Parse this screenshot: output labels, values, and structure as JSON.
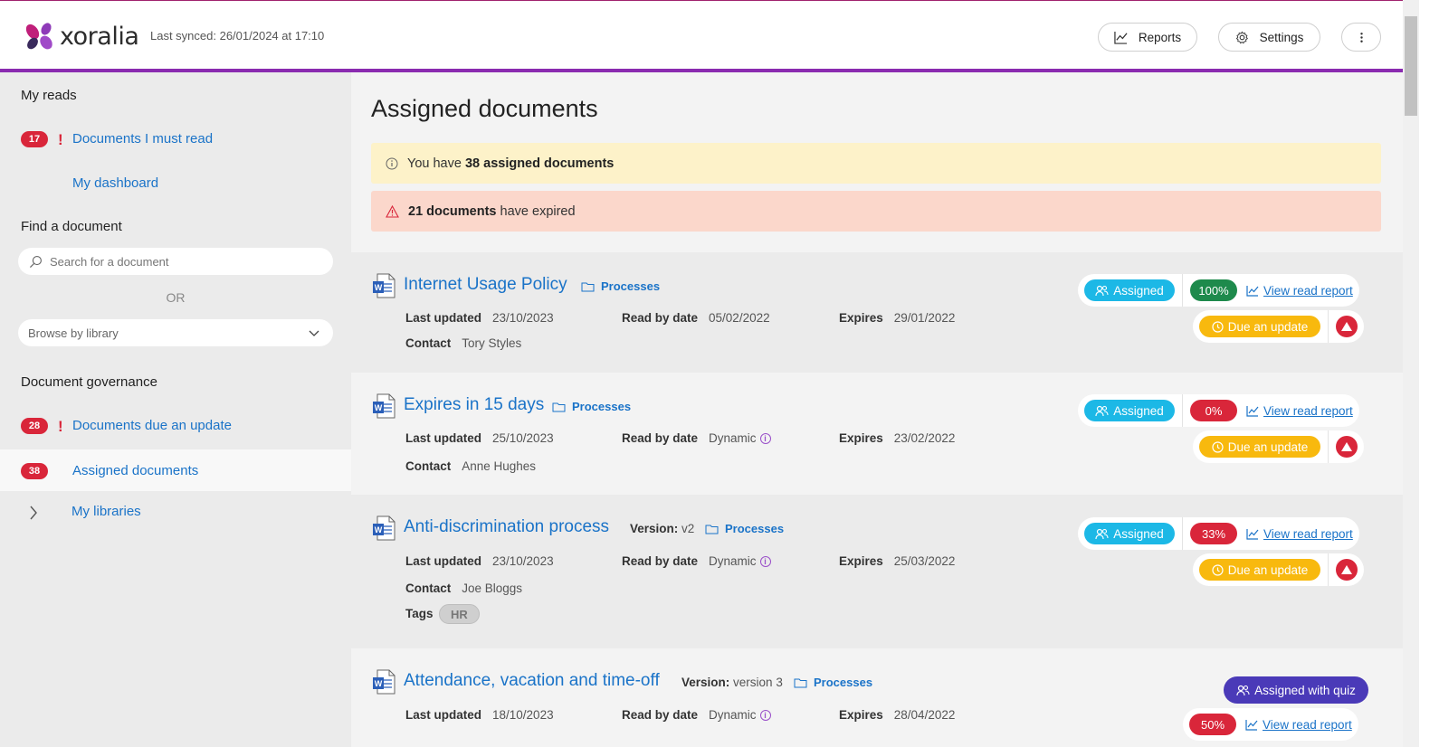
{
  "header": {
    "logo_text": "xoralia",
    "last_synced": "Last synced: 26/01/2024 at 17:10",
    "reports_label": "Reports",
    "settings_label": "Settings"
  },
  "sidebar": {
    "my_reads_heading": "My reads",
    "must_read_count": "17",
    "must_read_label": "Documents I must read",
    "dashboard_label": "My dashboard",
    "find_heading": "Find a document",
    "search_placeholder": "Search for a document",
    "or_label": "OR",
    "browse_label": "Browse by library",
    "governance_heading": "Document governance",
    "due_update_count": "28",
    "due_update_label": "Documents due an update",
    "assigned_count": "38",
    "assigned_label": "Assigned documents",
    "libraries_label": "My libraries"
  },
  "main": {
    "title": "Assigned documents",
    "info_prefix": "You have ",
    "info_bold": "38 assigned documents",
    "warn_bold": "21 documents",
    "warn_suffix": " have expired",
    "labels": {
      "last_updated": "Last updated",
      "read_by": "Read by date",
      "expires": "Expires",
      "contact": "Contact",
      "tags": "Tags",
      "version": "Version:",
      "view_report": "View read report",
      "due_update": "Due an update"
    },
    "docs": [
      {
        "title": "Internet Usage Policy",
        "folder": "Processes",
        "last_updated": "23/10/2023",
        "read_by": "05/02/2022",
        "expires": "29/01/2022",
        "contact": "Tory Styles",
        "status": "Assigned",
        "percent": "100%"
      },
      {
        "title": "Expires in 15 days",
        "folder": "Processes",
        "last_updated": "25/10/2023",
        "read_by": "Dynamic",
        "expires": "23/02/2022",
        "contact": "Anne Hughes",
        "status": "Assigned",
        "percent": "0%"
      },
      {
        "title": "Anti-discrimination process",
        "version": "v2",
        "folder": "Processes",
        "last_updated": "23/10/2023",
        "read_by": "Dynamic",
        "expires": "25/03/2022",
        "contact": "Joe Bloggs",
        "tag": "HR",
        "status": "Assigned",
        "percent": "33%"
      },
      {
        "title": "Attendance, vacation and time-off",
        "version": "version 3",
        "folder": "Processes",
        "last_updated": "18/10/2023",
        "read_by": "Dynamic",
        "expires": "28/04/2022",
        "status": "Assigned with quiz",
        "percent": "50%"
      }
    ]
  },
  "colors": {
    "brand_purple": "#8a2bb0",
    "link_blue": "#1a73c8",
    "badge_red": "#d9263a",
    "assigned_cyan": "#1cb8e6",
    "quiz_indigo": "#4a3ab8",
    "update_amber": "#f8b90e",
    "complete_green": "#1e8a4c"
  }
}
